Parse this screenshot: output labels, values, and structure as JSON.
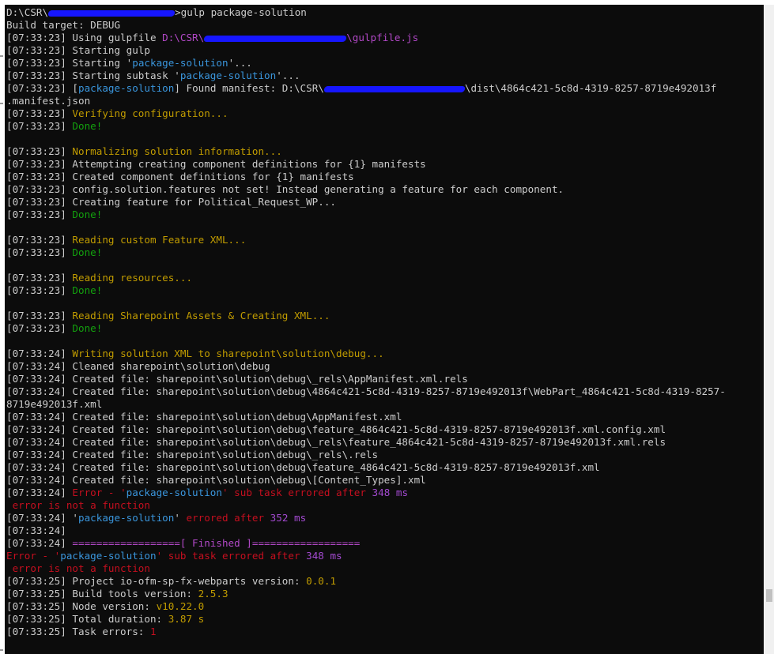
{
  "terminal": {
    "lines": [
      [
        {
          "t": "D:\\CSR\\",
          "c": "white"
        },
        {
          "r": 160
        },
        {
          "t": ">gulp package-solution",
          "c": "white"
        }
      ],
      [
        {
          "t": "Build target: DEBUG",
          "c": "white"
        }
      ],
      [
        {
          "t": "[07:33:23] Using gulpfile ",
          "c": "white"
        },
        {
          "t": "D:\\CSR\\",
          "c": "magenta"
        },
        {
          "r": 180
        },
        {
          "t": "\\gulpfile.js",
          "c": "magenta"
        }
      ],
      [
        {
          "t": "[07:33:23] Starting gulp",
          "c": "white"
        }
      ],
      [
        {
          "t": "[07:33:23] Starting '",
          "c": "white"
        },
        {
          "t": "package-solution",
          "c": "cyan"
        },
        {
          "t": "'...",
          "c": "white"
        }
      ],
      [
        {
          "t": "[07:33:23] Starting subtask '",
          "c": "white"
        },
        {
          "t": "package-solution",
          "c": "cyan"
        },
        {
          "t": "'...",
          "c": "white"
        }
      ],
      [
        {
          "t": "[07:33:23] [",
          "c": "white"
        },
        {
          "t": "package-solution",
          "c": "cyan"
        },
        {
          "t": "] Found manifest: D:\\CSR\\",
          "c": "white"
        },
        {
          "r": 178
        },
        {
          "t": "\\dist\\4864c421-5c8d-4319-8257-8719e492013f",
          "c": "white"
        }
      ],
      [
        {
          "t": ".manifest.json",
          "c": "white"
        }
      ],
      [
        {
          "t": "[07:33:23] ",
          "c": "white"
        },
        {
          "t": "Verifying configuration...",
          "c": "yellow"
        }
      ],
      [
        {
          "t": "[07:33:23] ",
          "c": "white"
        },
        {
          "t": "Done!",
          "c": "green"
        }
      ],
      [],
      [
        {
          "t": "[07:33:23] ",
          "c": "white"
        },
        {
          "t": "Normalizing solution information...",
          "c": "yellow"
        }
      ],
      [
        {
          "t": "[07:33:23] Attempting creating component definitions for {1} manifests",
          "c": "white"
        }
      ],
      [
        {
          "t": "[07:33:23] Created component definitions for {1} manifests",
          "c": "white"
        }
      ],
      [
        {
          "t": "[07:33:23] config.solution.features not set! Instead generating a feature for each component.",
          "c": "white"
        }
      ],
      [
        {
          "t": "[07:33:23] Creating feature for Political_Request_WP...",
          "c": "white"
        }
      ],
      [
        {
          "t": "[07:33:23] ",
          "c": "white"
        },
        {
          "t": "Done!",
          "c": "green"
        }
      ],
      [],
      [
        {
          "t": "[07:33:23] ",
          "c": "white"
        },
        {
          "t": "Reading custom Feature XML...",
          "c": "yellow"
        }
      ],
      [
        {
          "t": "[07:33:23] ",
          "c": "white"
        },
        {
          "t": "Done!",
          "c": "green"
        }
      ],
      [],
      [
        {
          "t": "[07:33:23] ",
          "c": "white"
        },
        {
          "t": "Reading resources...",
          "c": "yellow"
        }
      ],
      [
        {
          "t": "[07:33:23] ",
          "c": "white"
        },
        {
          "t": "Done!",
          "c": "green"
        }
      ],
      [],
      [
        {
          "t": "[07:33:23] ",
          "c": "white"
        },
        {
          "t": "Reading Sharepoint Assets & Creating XML...",
          "c": "yellow"
        }
      ],
      [
        {
          "t": "[07:33:23] ",
          "c": "white"
        },
        {
          "t": "Done!",
          "c": "green"
        }
      ],
      [],
      [
        {
          "t": "[07:33:24] ",
          "c": "white"
        },
        {
          "t": "Writing solution XML to sharepoint\\solution\\debug...",
          "c": "yellow"
        }
      ],
      [
        {
          "t": "[07:33:24] Cleaned sharepoint\\solution\\debug",
          "c": "white"
        }
      ],
      [
        {
          "t": "[07:33:24] Created file: sharepoint\\solution\\debug\\_rels\\AppManifest.xml.rels",
          "c": "white"
        }
      ],
      [
        {
          "t": "[07:33:24] Created file: sharepoint\\solution\\debug\\4864c421-5c8d-4319-8257-8719e492013f\\WebPart_4864c421-5c8d-4319-8257-",
          "c": "white"
        }
      ],
      [
        {
          "t": "8719e492013f.xml",
          "c": "white"
        }
      ],
      [
        {
          "t": "[07:33:24] Created file: sharepoint\\solution\\debug\\AppManifest.xml",
          "c": "white"
        }
      ],
      [
        {
          "t": "[07:33:24] Created file: sharepoint\\solution\\debug\\feature_4864c421-5c8d-4319-8257-8719e492013f.xml.config.xml",
          "c": "white"
        }
      ],
      [
        {
          "t": "[07:33:24] Created file: sharepoint\\solution\\debug\\_rels\\feature_4864c421-5c8d-4319-8257-8719e492013f.xml.rels",
          "c": "white"
        }
      ],
      [
        {
          "t": "[07:33:24] Created file: sharepoint\\solution\\debug\\_rels\\.rels",
          "c": "white"
        }
      ],
      [
        {
          "t": "[07:33:24] Created file: sharepoint\\solution\\debug\\feature_4864c421-5c8d-4319-8257-8719e492013f.xml",
          "c": "white"
        }
      ],
      [
        {
          "t": "[07:33:24] Created file: sharepoint\\solution\\debug\\[Content_Types].xml",
          "c": "white"
        }
      ],
      [
        {
          "t": "[07:33:24] ",
          "c": "white"
        },
        {
          "t": "Error - '",
          "c": "red"
        },
        {
          "t": "package-solution",
          "c": "cyan"
        },
        {
          "t": "' sub task errored after ",
          "c": "red"
        },
        {
          "t": "348 ms",
          "c": "purple"
        }
      ],
      [
        {
          "t": " error is not a function",
          "c": "red"
        }
      ],
      [
        {
          "t": "[07:33:24] '",
          "c": "white"
        },
        {
          "t": "package-solution",
          "c": "cyan"
        },
        {
          "t": "' ",
          "c": "white"
        },
        {
          "t": "errored after ",
          "c": "red"
        },
        {
          "t": "352 ms",
          "c": "purple"
        }
      ],
      [
        {
          "t": "[07:33:24]",
          "c": "white"
        }
      ],
      [
        {
          "t": "[07:33:24] ",
          "c": "white"
        },
        {
          "t": "==================[ Finished ]==================",
          "c": "magenta"
        }
      ],
      [
        {
          "t": "Error - '",
          "c": "red"
        },
        {
          "t": "package-solution",
          "c": "cyan"
        },
        {
          "t": "' sub task errored after ",
          "c": "red"
        },
        {
          "t": "348 ms",
          "c": "purple"
        }
      ],
      [
        {
          "t": " error is not a function",
          "c": "red"
        }
      ],
      [
        {
          "t": "[07:33:25] Project io-ofm-sp-fx-webparts version: ",
          "c": "white"
        },
        {
          "t": "0.0.1",
          "c": "yellow"
        }
      ],
      [
        {
          "t": "[07:33:25] Build tools version: ",
          "c": "white"
        },
        {
          "t": "2.5.3",
          "c": "yellow"
        }
      ],
      [
        {
          "t": "[07:33:25] Node version: ",
          "c": "white"
        },
        {
          "t": "v10.22.0",
          "c": "yellow"
        }
      ],
      [
        {
          "t": "[07:33:25] Total duration: ",
          "c": "white"
        },
        {
          "t": "3.87 s",
          "c": "yellow"
        }
      ],
      [
        {
          "t": "[07:33:25] Task errors: ",
          "c": "white"
        },
        {
          "t": "1",
          "c": "red"
        }
      ]
    ]
  },
  "colors": {
    "background": "#0c0c0c",
    "text": "#cccccc",
    "yellow": "#c19c00",
    "green": "#13a10e",
    "cyan": "#3a96dd",
    "magenta": "#b148c6",
    "red": "#c50f1f",
    "redaction": "#1616ff"
  }
}
